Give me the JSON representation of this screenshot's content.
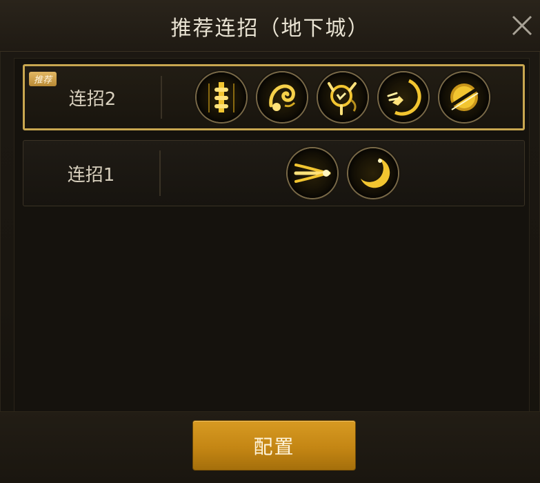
{
  "dialog": {
    "title": "推荐连招（地下城）",
    "close_icon": "close-icon"
  },
  "combos": [
    {
      "label": "连招2",
      "badge": "推荐",
      "selected": true,
      "skills": [
        "skill-icon-pillar",
        "skill-icon-dragon",
        "skill-icon-beast",
        "skill-icon-dash",
        "skill-icon-slash-orb"
      ]
    },
    {
      "label": "连招1",
      "badge": "",
      "selected": false,
      "skills": [
        "skill-icon-wind-slash",
        "skill-icon-crescent"
      ]
    }
  ],
  "footer": {
    "config_label": "配置"
  },
  "colors": {
    "accent_gold": "#c9a750",
    "button_orange": "#c48614",
    "panel_bg": "#1a1610"
  }
}
